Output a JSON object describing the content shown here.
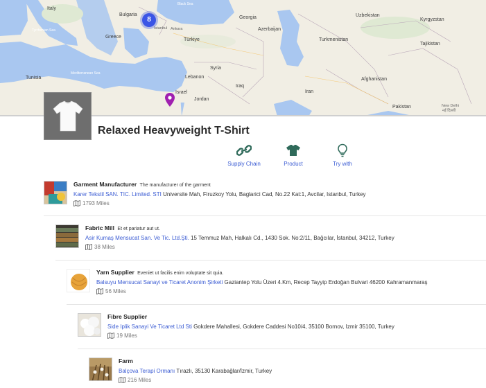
{
  "map": {
    "cluster_count": "8",
    "labels": {
      "italy": "Italy",
      "bulgaria": "Bulgaria",
      "greece": "Greece",
      "tyrrhenian": "Tyrrhenian Sea",
      "black_sea": "Black Sea",
      "ankara": "Ankara",
      "istanbul": "İstanbul",
      "turkiye": "Türkiye",
      "georgia": "Georgia",
      "azerbaijan": "Azerbaijan",
      "uzbekistan": "Uzbekistan",
      "kyrgyzstan": "Kyrgyzstan",
      "turkmenistan": "Turkmenistan",
      "tajikistan": "Tajikistan",
      "tunisia": "Tunisia",
      "mediterranean": "Mediterranean Sea",
      "syria": "Syria",
      "lebanon": "Lebanon",
      "israel": "Israel",
      "iraq": "Iraq",
      "jordan": "Jordan",
      "iran": "Iran",
      "afghanistan": "Afghanistan",
      "pakistan": "Pakistan",
      "new_delhi": "New Delhi",
      "new_delhi_local": "नई दिल्ली"
    }
  },
  "product": {
    "title": "Relaxed Heavyweight T-Shirt"
  },
  "actions": {
    "supply_chain": "Supply Chain",
    "product": "Product",
    "try_with": "Try with"
  },
  "steps": [
    {
      "role": "Garment Manufacturer",
      "description": "The manufacturer of the garment",
      "company": "Karer Tekstil SAN. TIC. Limited. STI",
      "address": "Universite Mah, Firuzkoy Yolu, Baglarici Cad, No.22 Kat:1, Avcilar, Istanbul, Turkey",
      "distance": "1793 Miles"
    },
    {
      "role": "Fabric Mill",
      "description": "Et et pariatur aut ut.",
      "company": "Asir Kumaş Mensucat San. Ve Tic. Ltd.Şti.",
      "address": "15 Temmuz Mah, Halkalı Cd., 1430 Sok. No:2/11, Bağcılar, İstanbul, 34212, Turkey",
      "distance": "38 Miles"
    },
    {
      "role": "Yarn Supplier",
      "description": "Eveniet ut facilis enim voluptate sit quia.",
      "company": "Balsuyu Mensucat Sanayi ve Ticaret Anonim Şirketi",
      "address": "Gaziantep Yolu Üzeri 4.Km, Recep Tayyip Erdoğan Bulvari 46200 Kahramanmaraş",
      "distance": "56 Miles"
    },
    {
      "role": "Fibre Supplier",
      "description": "",
      "company": "Side Iplik Sanayi Ve Ticaret Ltd Sti",
      "address": "Gokdere Mahallesi, Gokdere Caddesi No10/4, 35100 Bornov, Izmir 35100, Turkey",
      "distance": "19 Miles"
    },
    {
      "role": "Farm",
      "description": "",
      "company": "Balçova Terapi Ormanı",
      "address": "Tırazlı, 35130 Karabağlar/İzmir, Turkey",
      "distance": "216 Miles"
    }
  ]
}
